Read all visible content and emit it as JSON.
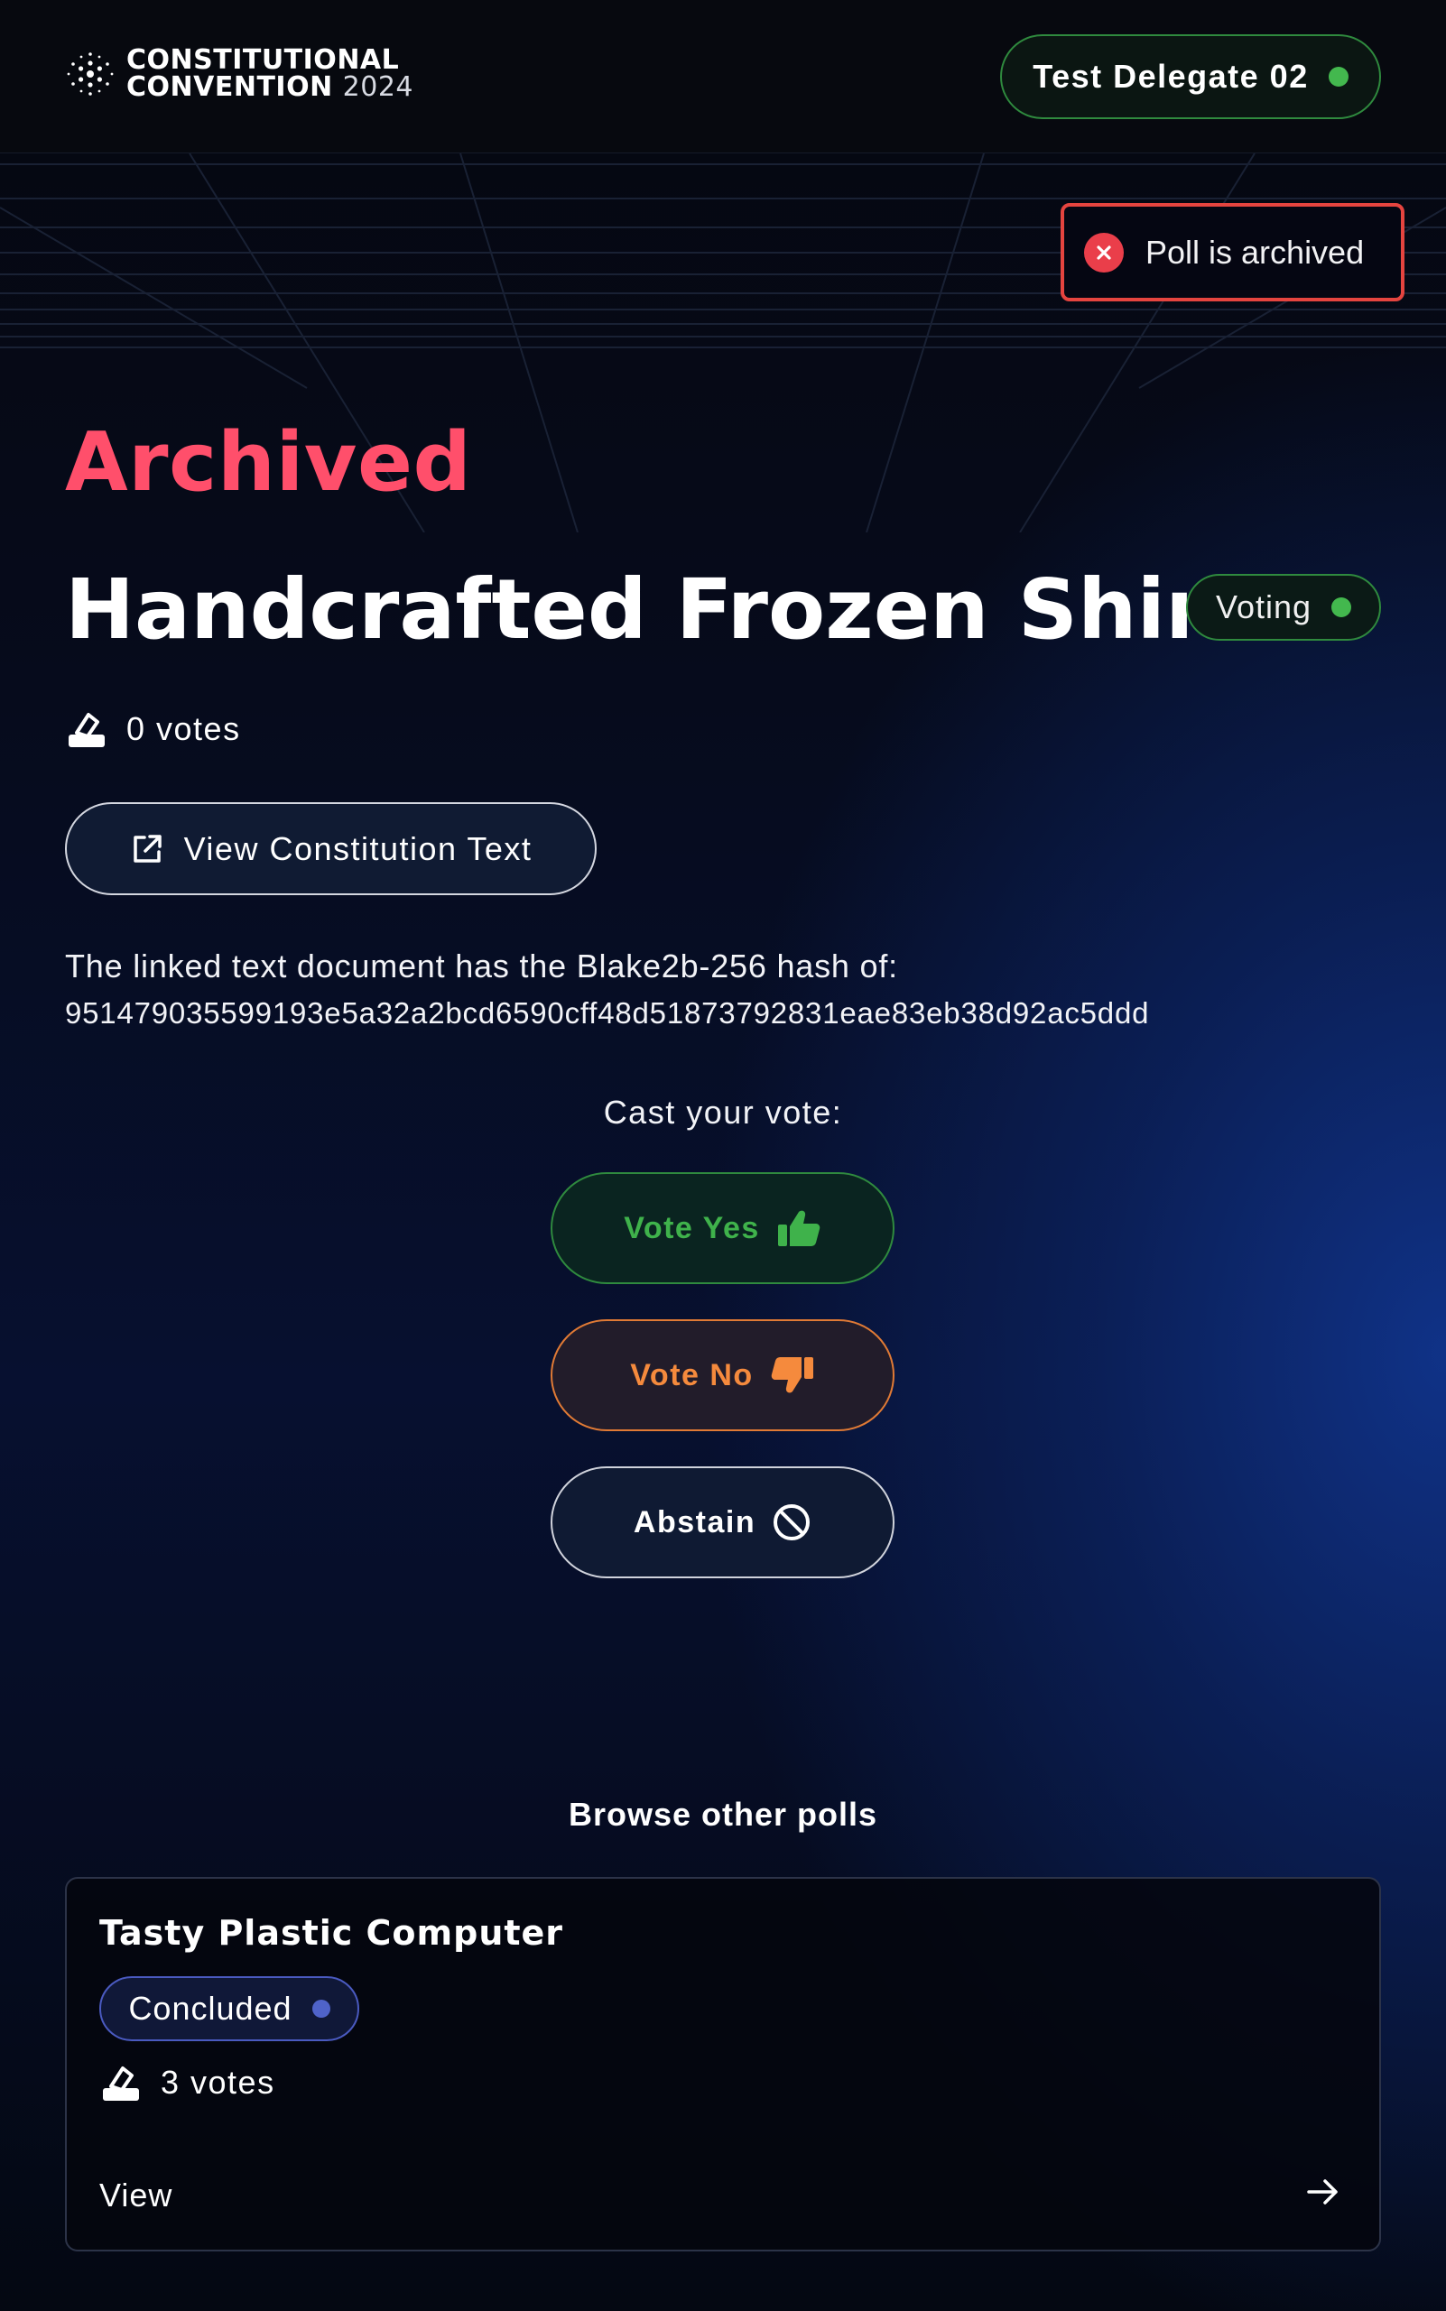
{
  "header": {
    "logo_line1": "CONSTITUTIONAL",
    "logo_line2": "CONVENTION",
    "logo_year": "2024",
    "logo_icon": "cardano-logo-icon",
    "delegate_label": "Test Delegate 02",
    "delegate_status_color": "#43b84e"
  },
  "toast": {
    "message": "Poll is archived",
    "icon": "error-x-icon",
    "color": "#e5443f"
  },
  "poll": {
    "status_title": "Archived",
    "title": "Handcrafted Frozen Shirt",
    "badge": "Voting",
    "badge_color": "#43b84e",
    "votes": "0 votes",
    "votes_icon": "ballot-box-icon",
    "view_text_label": "View Constitution Text",
    "view_text_icon": "external-link-icon",
    "hash_label": "The linked text document has the Blake2b-256 hash of:",
    "hash_value": "951479035599193e5a32a2bcd6590cff48d51873792831eae83eb38d92ac5ddd"
  },
  "vote": {
    "cast_label": "Cast your vote:",
    "yes_label": "Vote Yes",
    "yes_icon": "thumbs-up-icon",
    "no_label": "Vote No",
    "no_icon": "thumbs-down-icon",
    "abstain_label": "Abstain",
    "abstain_icon": "prohibited-icon",
    "colors": {
      "yes": "#3fb24b",
      "no": "#f58a3d",
      "abstain": "#ffffff"
    }
  },
  "browse": {
    "heading": "Browse other polls",
    "cards": [
      {
        "title": "Tasty Plastic Computer",
        "badge": "Concluded",
        "badge_color": "#4f63c9",
        "votes": "3 votes",
        "view_label": "View",
        "arrow_icon": "arrow-right-icon"
      }
    ]
  }
}
